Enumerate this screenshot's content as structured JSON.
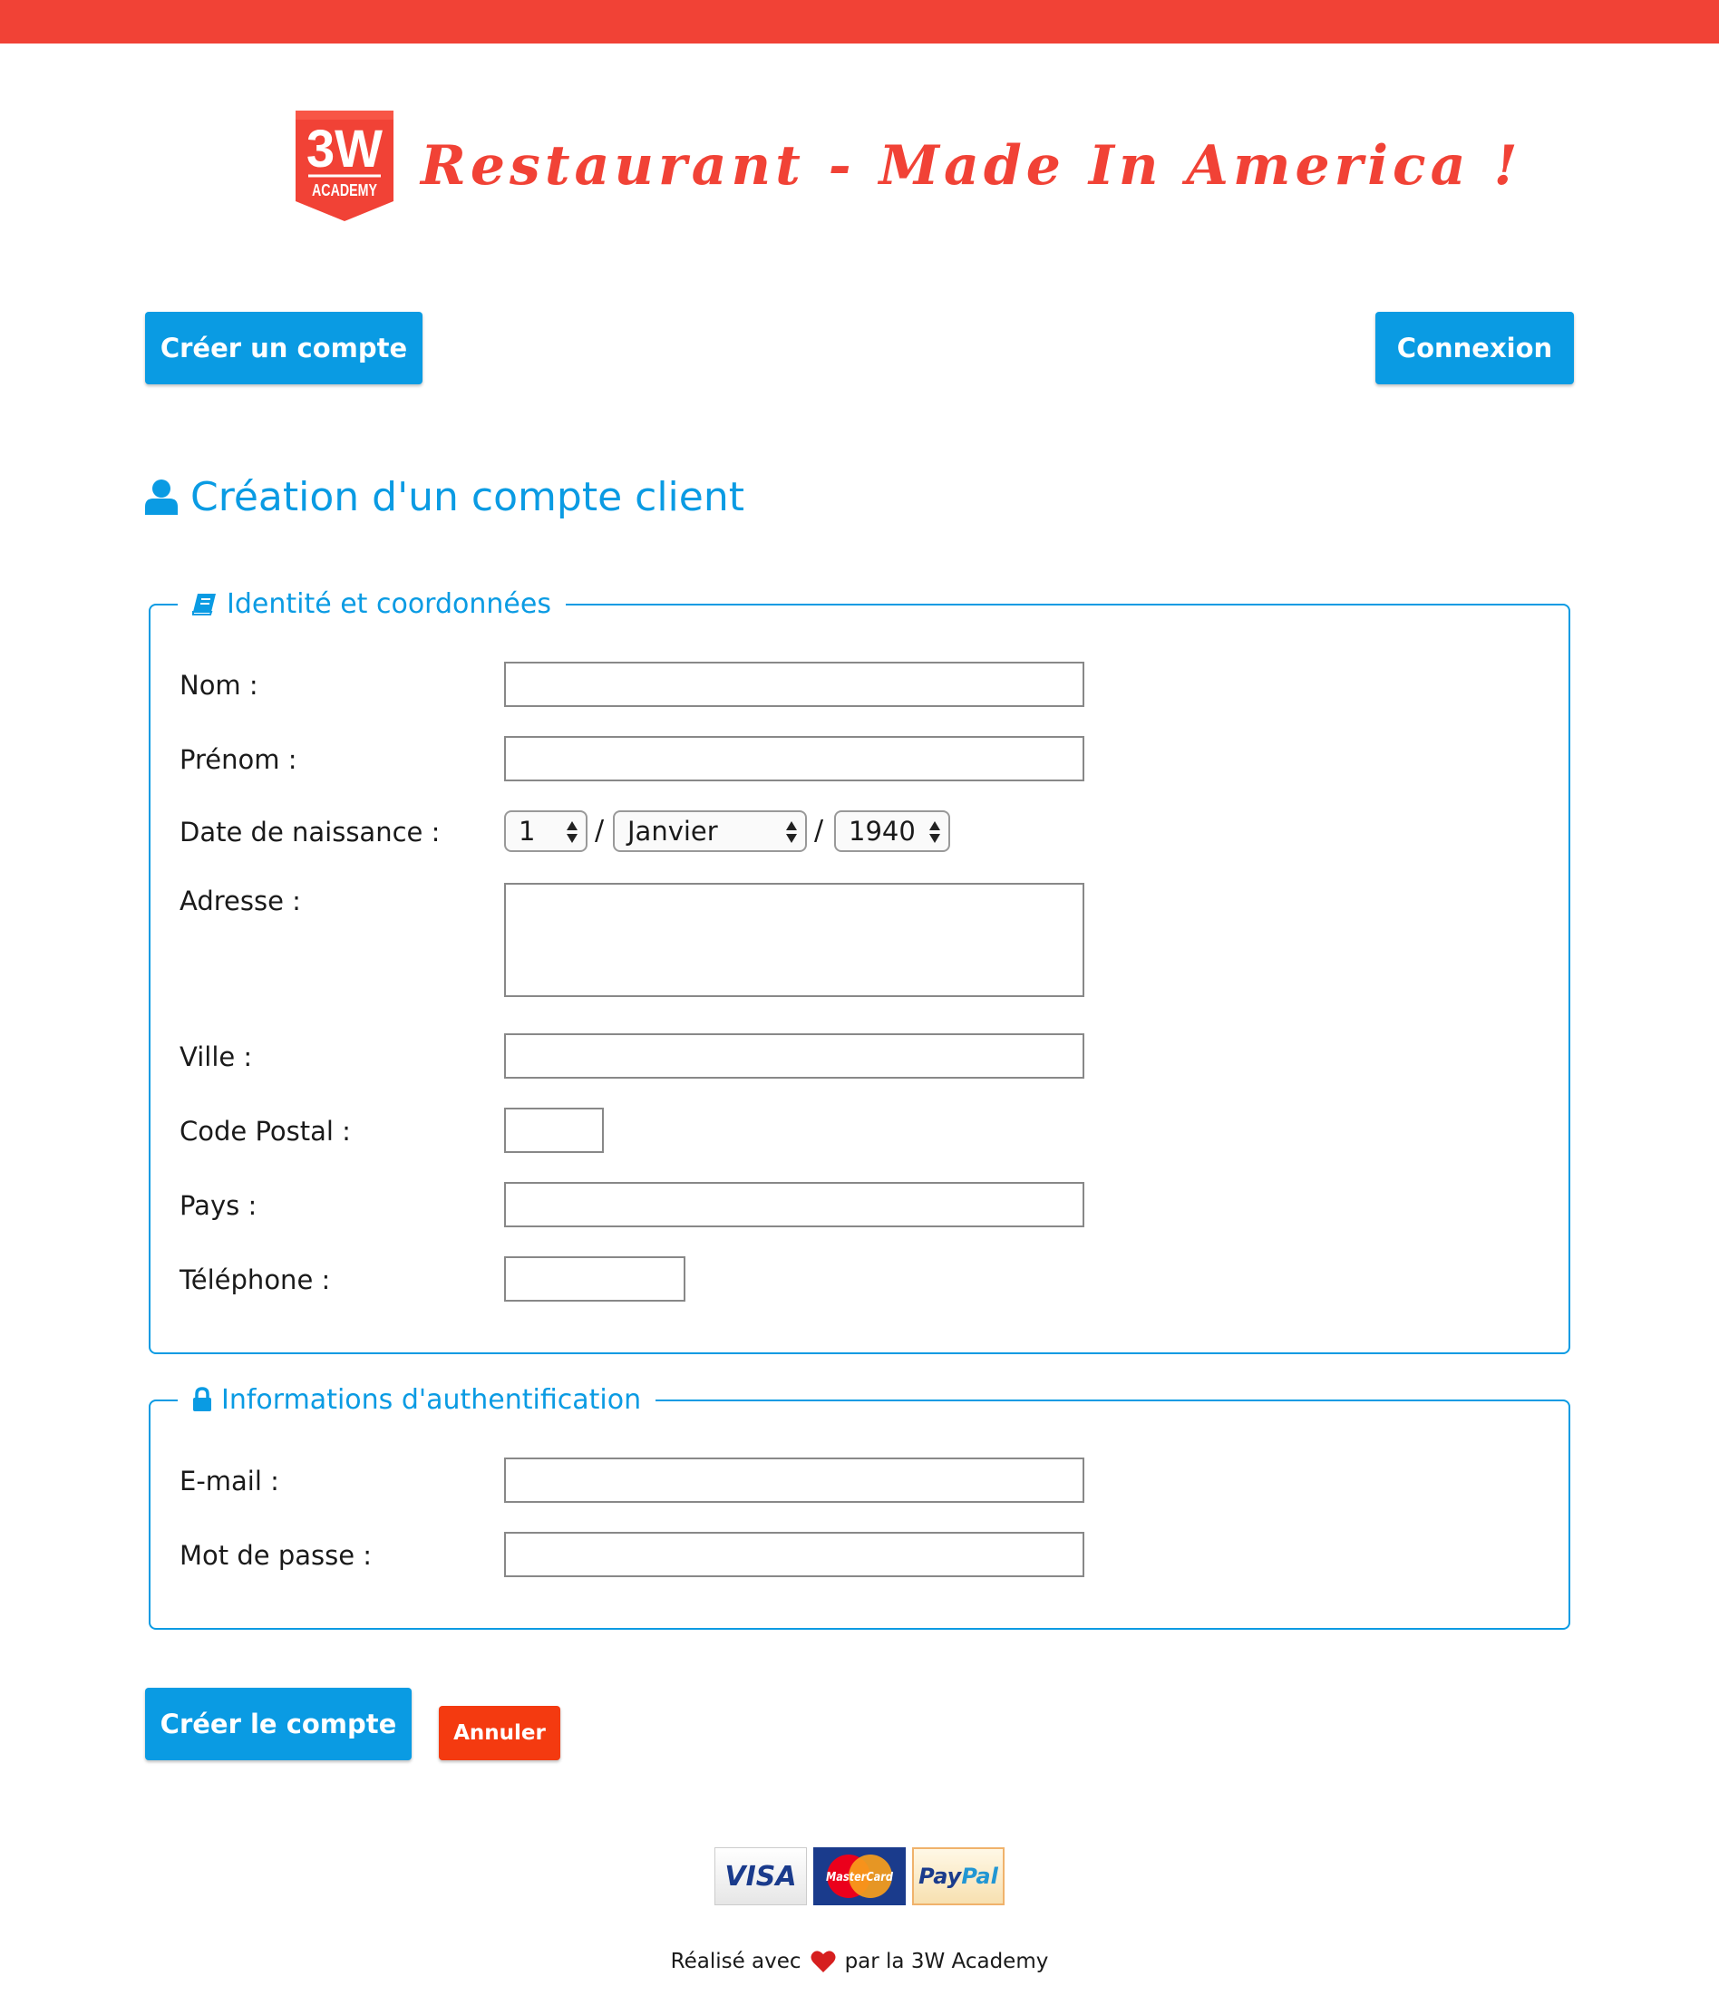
{
  "colors": {
    "brand_red": "#f14236",
    "accent_blue": "#0a9be3",
    "cancel_red": "#f43a10"
  },
  "header": {
    "logo": {
      "big": "3W",
      "small": "ACADEMY",
      "icon": "3w-academy-logo"
    },
    "title": "Restaurant - Made In America !"
  },
  "nav": {
    "create_account": "Créer un compte",
    "login": "Connexion"
  },
  "page_title": {
    "icon": "user-icon",
    "text": "Création d'un compte client"
  },
  "identity": {
    "legend": "Identité et coordonnées",
    "legend_icon": "book-icon",
    "labels": {
      "lastname": "Nom :",
      "firstname": "Prénom :",
      "birthdate": "Date de naissance :",
      "address": "Adresse :",
      "city": "Ville :",
      "zip": "Code Postal :",
      "country": "Pays :",
      "phone": "Téléphone :"
    },
    "values": {
      "lastname": "",
      "firstname": "",
      "address": "",
      "city": "",
      "zip": "",
      "country": "",
      "phone": ""
    },
    "birth_day": "1",
    "birth_month": "Janvier",
    "birth_year": "1940",
    "separator": "/"
  },
  "auth": {
    "legend": "Informations d'authentification",
    "legend_icon": "lock-icon",
    "labels": {
      "email": "E-mail :",
      "password": "Mot de passe :"
    },
    "values": {
      "email": "",
      "password": ""
    }
  },
  "actions": {
    "submit": "Créer le compte",
    "cancel": "Annuler"
  },
  "footer": {
    "payments": {
      "visa": "VISA",
      "mastercard": "MasterCard",
      "paypal_a": "Pay",
      "paypal_b": "Pal"
    },
    "credit_before": "Réalisé avec",
    "credit_after": "par la 3W Academy",
    "heart_icon": "heart-icon"
  }
}
